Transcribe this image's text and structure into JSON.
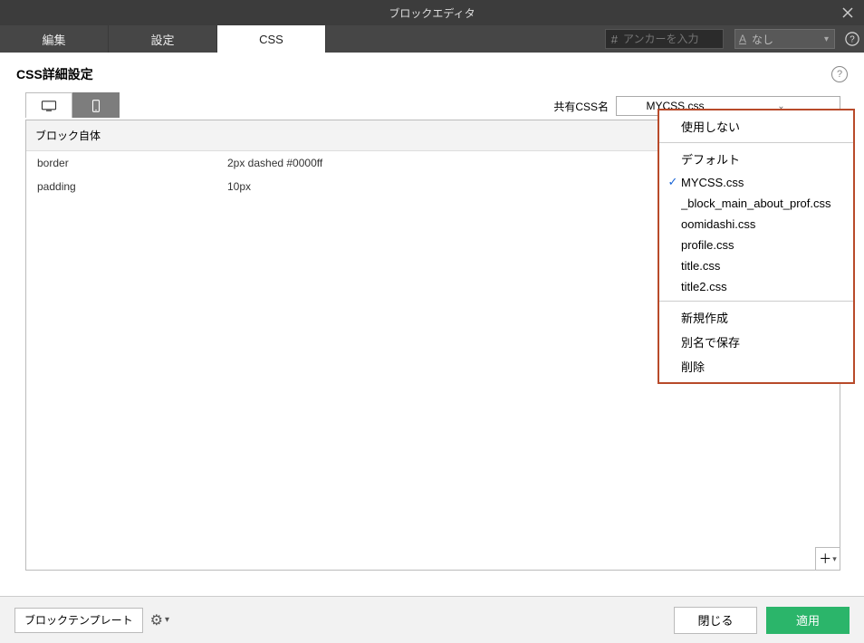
{
  "titlebar": {
    "title": "ブロックエディタ"
  },
  "tabs": {
    "edit": "編集",
    "settings": "設定",
    "css": "CSS"
  },
  "anchor": {
    "hash": "#",
    "placeholder": "アンカーを入力"
  },
  "font": {
    "icon": "A",
    "label": "なし"
  },
  "subheader": {
    "title": "CSS詳細設定"
  },
  "sharecss": {
    "label": "共有CSS名",
    "selected": "MYCSS.css"
  },
  "panel": {
    "section": "ブロック自体",
    "props": [
      {
        "k": "border",
        "v": "2px dashed #0000ff"
      },
      {
        "k": "padding",
        "v": "10px"
      }
    ]
  },
  "dropdown": {
    "groups": [
      {
        "items": [
          {
            "label": "使用しない",
            "checked": false
          }
        ]
      },
      {
        "items": [
          {
            "label": "デフォルト",
            "checked": false
          },
          {
            "label": "MYCSS.css",
            "checked": true
          },
          {
            "label": "_block_main_about_prof.css",
            "checked": false
          },
          {
            "label": "oomidashi.css",
            "checked": false
          },
          {
            "label": "profile.css",
            "checked": false
          },
          {
            "label": "title.css",
            "checked": false
          },
          {
            "label": "title2.css",
            "checked": false
          }
        ]
      },
      {
        "items": [
          {
            "label": "新規作成",
            "checked": false
          },
          {
            "label": "別名で保存",
            "checked": false
          },
          {
            "label": "削除",
            "checked": false
          }
        ]
      }
    ]
  },
  "footer": {
    "template_btn": "ブロックテンプレート",
    "close": "閉じる",
    "apply": "適用"
  }
}
